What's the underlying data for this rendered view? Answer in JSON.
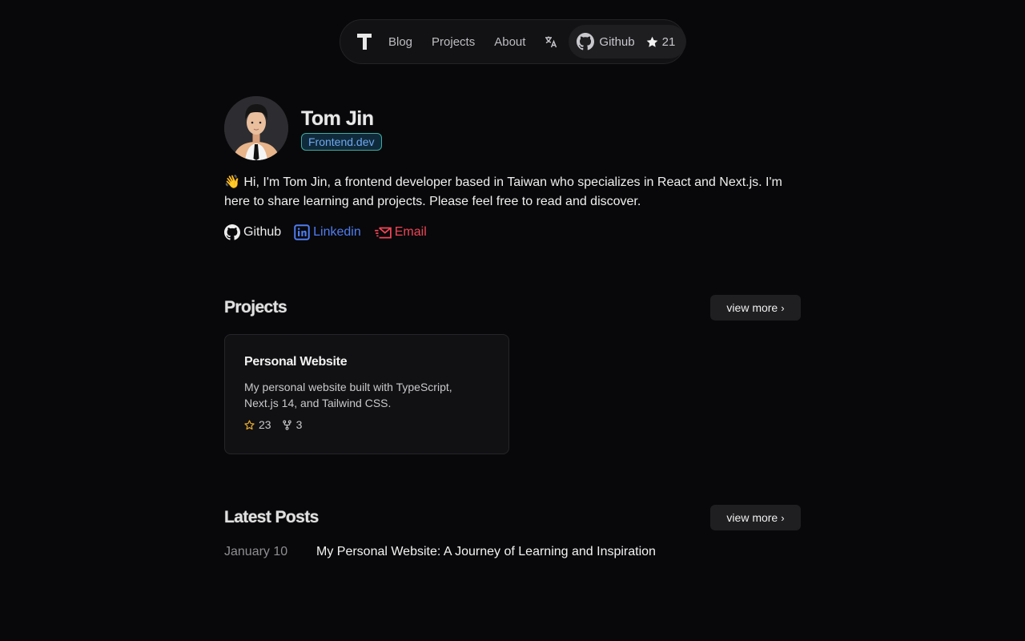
{
  "nav": {
    "logo_icon": "t-logo-icon",
    "links": [
      {
        "label": "Blog"
      },
      {
        "label": "Projects"
      },
      {
        "label": "About"
      }
    ],
    "translate_icon": "translate-icon",
    "github": {
      "label": "Github",
      "stars": "21"
    }
  },
  "profile": {
    "name": "Tom Jin",
    "badge": "Frontend.dev",
    "bio": "👋 Hi, I'm Tom Jin, a frontend developer based in Taiwan who specializes in React and Next.js. I'm here to share learning and projects. Please feel free to read and discover.",
    "socials": [
      {
        "label": "Github",
        "icon": "github-icon",
        "color": "#ededed"
      },
      {
        "label": "Linkedin",
        "icon": "linkedin-icon",
        "color": "#4f7cf0"
      },
      {
        "label": "Email",
        "icon": "email-icon",
        "color": "#ef4556"
      }
    ]
  },
  "projects": {
    "title": "Projects",
    "view_more": "view more",
    "items": [
      {
        "title": "Personal Website",
        "description": "My personal website built with TypeScript, Next.js 14, and Tailwind CSS.",
        "stars": "23",
        "forks": "3"
      }
    ]
  },
  "posts": {
    "title": "Latest Posts",
    "view_more": "view more",
    "items": [
      {
        "date": "January 10",
        "title": "My Personal Website: A Journey of Learning and Inspiration"
      }
    ]
  },
  "colors": {
    "background": "#08080a",
    "accent_badge": "#6fa6f0",
    "badge_border": "#3ea9a0",
    "star": "#e3a92b"
  }
}
